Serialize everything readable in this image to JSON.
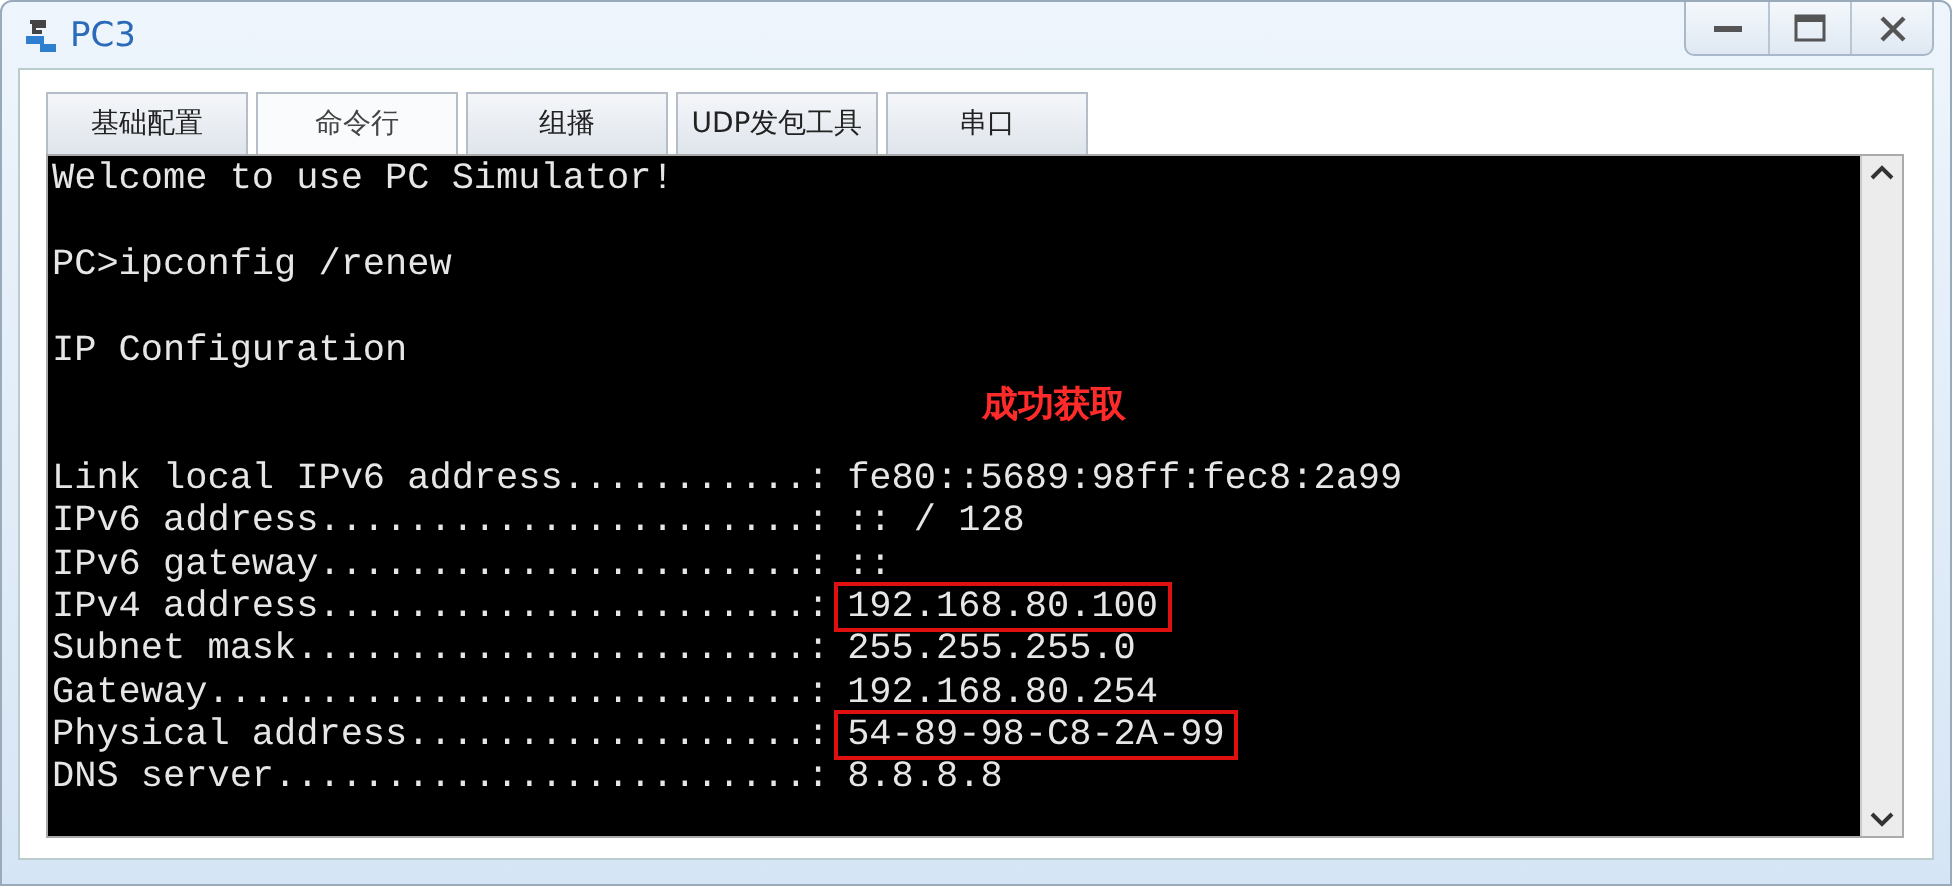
{
  "window": {
    "title": "PC3"
  },
  "tabs": [
    {
      "label": "基础配置",
      "selected": false
    },
    {
      "label": "命令行",
      "selected": true
    },
    {
      "label": "组播",
      "selected": false
    },
    {
      "label": "UDP发包工具",
      "selected": false
    },
    {
      "label": "串口",
      "selected": false
    }
  ],
  "terminal": {
    "lines": [
      {
        "kind": "text",
        "text": "Welcome to use PC Simulator!"
      },
      {
        "kind": "blank"
      },
      {
        "kind": "text",
        "text": "PC>ipconfig /renew"
      },
      {
        "kind": "blank"
      },
      {
        "kind": "text",
        "text": "IP Configuration"
      },
      {
        "kind": "blank"
      },
      {
        "kind": "blank"
      },
      {
        "kind": "field",
        "label": "Link local IPv6 address...........:",
        "value": "fe80::5689:98ff:fec8:2a99",
        "boxed": false
      },
      {
        "kind": "field",
        "label": "IPv6 address......................:",
        "value": ":: / 128",
        "boxed": false
      },
      {
        "kind": "field",
        "label": "IPv6 gateway......................:",
        "value": "::",
        "boxed": false
      },
      {
        "kind": "field",
        "label": "IPv4 address......................:",
        "value": "192.168.80.100",
        "boxed": true
      },
      {
        "kind": "field",
        "label": "Subnet mask.......................:",
        "value": "255.255.255.0",
        "boxed": false
      },
      {
        "kind": "field",
        "label": "Gateway...........................:",
        "value": "192.168.80.254",
        "boxed": false
      },
      {
        "kind": "field",
        "label": "Physical address..................:",
        "value": "54-89-98-C8-2A-99",
        "boxed": true
      },
      {
        "kind": "field",
        "label": "DNS server........................:",
        "value": "8.8.8.8",
        "boxed": false
      }
    ],
    "annotation": "成功获取"
  }
}
